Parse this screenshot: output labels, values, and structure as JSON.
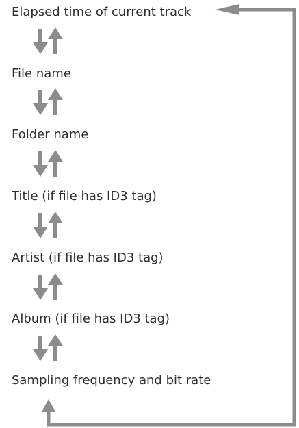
{
  "diagram": {
    "steps": [
      {
        "label": "Elapsed time of current track"
      },
      {
        "label": "File name"
      },
      {
        "label": "Folder name"
      },
      {
        "label": "Title (if file has ID3 tag)"
      },
      {
        "label": "Artist (if file has ID3 tag)"
      },
      {
        "label": "Album (if file has ID3 tag)"
      },
      {
        "label": "Sampling frequency and bit rate"
      }
    ],
    "arrow_color": "#8c8c8c",
    "text_color": "#2f2f2f"
  }
}
